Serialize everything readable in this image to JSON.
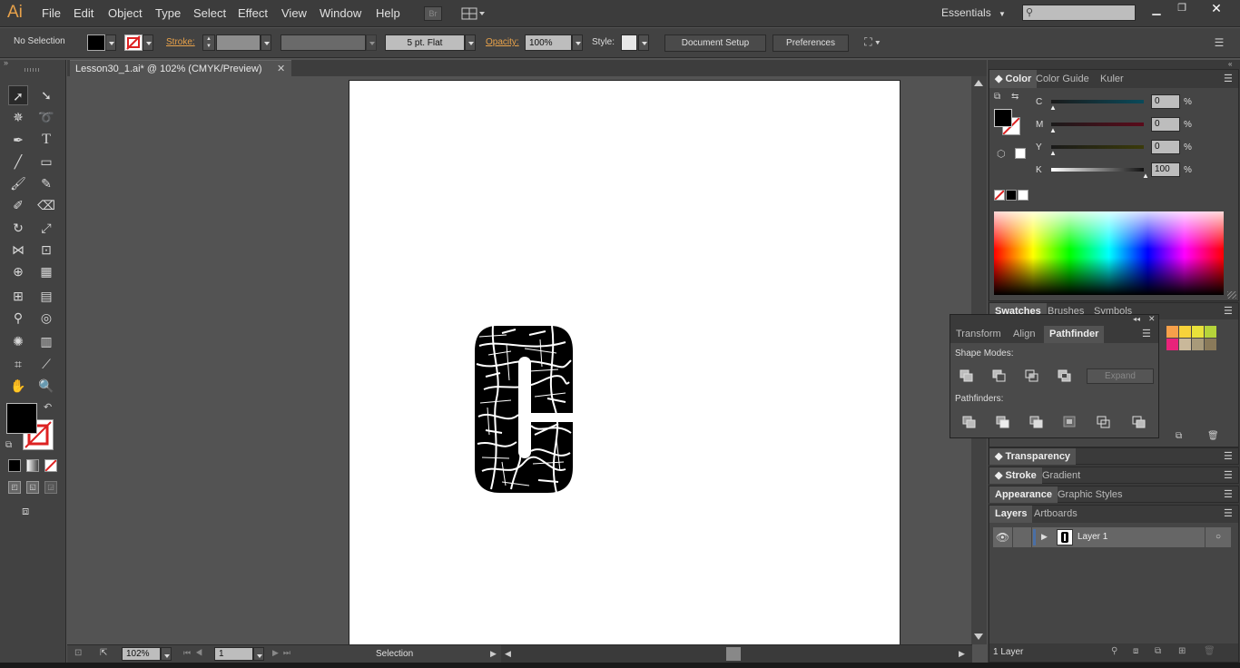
{
  "app": {
    "logo": "Ai"
  },
  "menu": [
    "File",
    "Edit",
    "Object",
    "Type",
    "Select",
    "Effect",
    "View",
    "Window",
    "Help"
  ],
  "bridge_label": "Br",
  "workspace": {
    "label": "Essentials"
  },
  "search": {
    "placeholder": ""
  },
  "control": {
    "selection_label": "No Selection",
    "stroke_label": "Stroke:",
    "brush_value": "5 pt. Flat",
    "opacity_label": "Opacity:",
    "opacity_value": "100%",
    "style_label": "Style:",
    "document_setup": "Document Setup",
    "preferences": "Preferences"
  },
  "document": {
    "tab_title": "Lesson30_1.ai* @ 102% (CMYK/Preview)"
  },
  "status": {
    "zoom": "102%",
    "artboard": "1",
    "tool": "Selection"
  },
  "color_panel": {
    "tabs": [
      "Color",
      "Color Guide",
      "Kuler"
    ],
    "channels": [
      {
        "label": "C",
        "value": "0",
        "unit": "%"
      },
      {
        "label": "M",
        "value": "0",
        "unit": "%"
      },
      {
        "label": "Y",
        "value": "0",
        "unit": "%"
      },
      {
        "label": "K",
        "value": "100",
        "unit": "%"
      }
    ]
  },
  "swatches_panel": {
    "tabs": [
      "Swatches",
      "Brushes",
      "Symbols"
    ]
  },
  "pathfinder_panel": {
    "tabs": [
      "Transform",
      "Align",
      "Pathfinder"
    ],
    "shape_modes_label": "Shape Modes:",
    "expand_label": "Expand",
    "pathfinders_label": "Pathfinders:"
  },
  "collapsed_panels": {
    "transparency": "Transparency",
    "stroke": "Stroke",
    "gradient": "Gradient",
    "appearance": "Appearance",
    "graphic_styles": "Graphic Styles"
  },
  "layers_panel": {
    "tabs": [
      "Layers",
      "Artboards"
    ],
    "layer_name": "Layer 1",
    "footer": "1 Layer"
  },
  "colors": {
    "accent_orange": "#e8a24a",
    "ui_dark": "#3c3c3c",
    "layer_highlight": "#4a6fa5"
  }
}
